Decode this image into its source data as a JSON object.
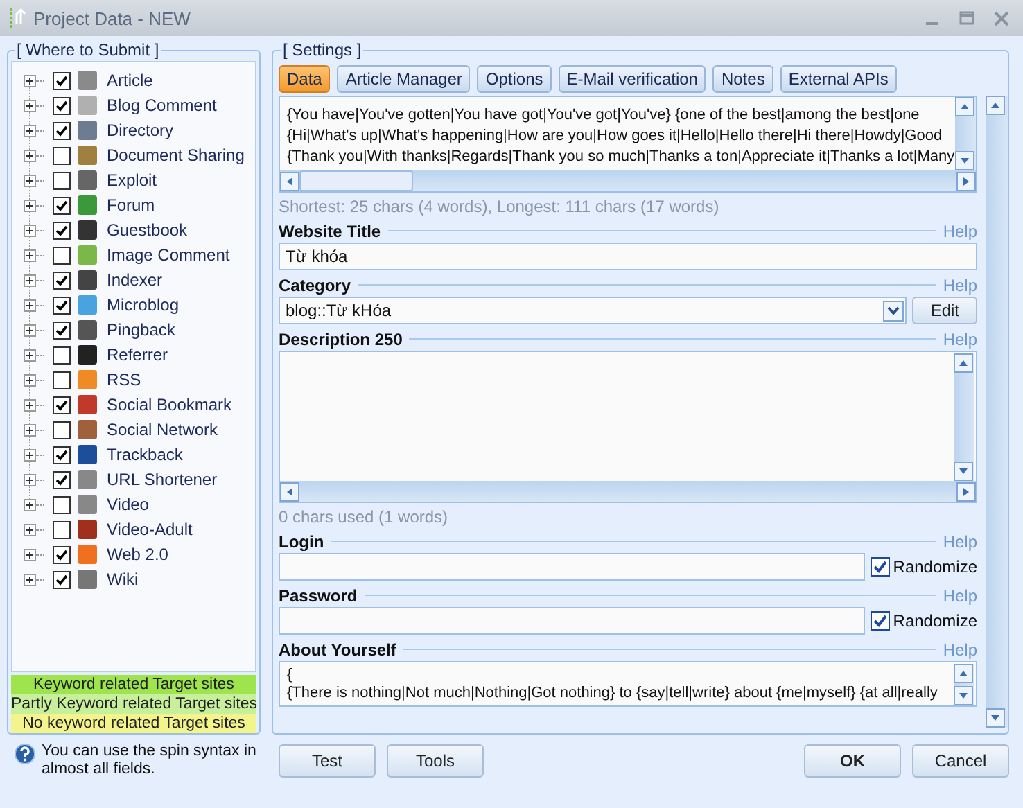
{
  "window": {
    "title": "Project Data - NEW"
  },
  "where_to_submit": {
    "title": "[ Where to Submit ]",
    "items": [
      {
        "label": "Article",
        "checked": true
      },
      {
        "label": "Blog Comment",
        "checked": true
      },
      {
        "label": "Directory",
        "checked": true
      },
      {
        "label": "Document Sharing",
        "checked": false
      },
      {
        "label": "Exploit",
        "checked": false
      },
      {
        "label": "Forum",
        "checked": true
      },
      {
        "label": "Guestbook",
        "checked": true
      },
      {
        "label": "Image Comment",
        "checked": false
      },
      {
        "label": "Indexer",
        "checked": true
      },
      {
        "label": "Microblog",
        "checked": true
      },
      {
        "label": "Pingback",
        "checked": true
      },
      {
        "label": "Referrer",
        "checked": false
      },
      {
        "label": "RSS",
        "checked": false
      },
      {
        "label": "Social Bookmark",
        "checked": true
      },
      {
        "label": "Social Network",
        "checked": false
      },
      {
        "label": "Trackback",
        "checked": true
      },
      {
        "label": "URL Shortener",
        "checked": true
      },
      {
        "label": "Video",
        "checked": false
      },
      {
        "label": "Video-Adult",
        "checked": false
      },
      {
        "label": "Web 2.0",
        "checked": true
      },
      {
        "label": "Wiki",
        "checked": true
      }
    ],
    "legend": [
      {
        "label": "Keyword related Target sites",
        "color": "#9ee44c"
      },
      {
        "label": "Partly Keyword related Target sites",
        "color": "#c8f09c"
      },
      {
        "label": "No keyword related Target sites",
        "color": "#f4f48c"
      }
    ]
  },
  "hint": "You can use the spin syntax in almost all fields.",
  "settings": {
    "title": "[ Settings ]",
    "tabs": [
      {
        "label": "Data",
        "selected": true
      },
      {
        "label": "Article Manager",
        "selected": false
      },
      {
        "label": "Options",
        "selected": false
      },
      {
        "label": "E-Mail verification",
        "selected": false
      },
      {
        "label": "Notes",
        "selected": false
      },
      {
        "label": "External APIs",
        "selected": false
      }
    ],
    "spin_lines": [
      "{You have|You've gotten|You have got|You've got|You've} {one of the best|among the best|one",
      "{Hi|What's up|What's happening|How are you|How goes it|Hello|Hello there|Hi there|Howdy|Good",
      "{Thank you|With thanks|Regards|Thank you so much|Thanks a ton|Appreciate it|Thanks a lot|Many"
    ],
    "spin_stats": "Shortest: 25 chars (4 words), Longest: 111 chars (17 words)",
    "fields": [
      {
        "kind": "text",
        "label": "Website Title",
        "help": "Help",
        "value": "Từ khóa"
      },
      {
        "kind": "select",
        "label": "Category",
        "help": "Help",
        "value": "blog::Từ kHóa",
        "button": "Edit"
      },
      {
        "kind": "textarea",
        "label": "Description 250",
        "help": "Help",
        "counter": "0 chars used (1 words)"
      },
      {
        "kind": "random",
        "label": "Login",
        "help": "Help",
        "randomize": {
          "label": "Randomize",
          "checked": true
        }
      },
      {
        "kind": "random",
        "label": "Password",
        "help": "Help",
        "randomize": {
          "label": "Randomize",
          "checked": true
        }
      },
      {
        "kind": "memo",
        "label": "About Yourself",
        "help": "Help",
        "lines": [
          "{",
          "{There is nothing|Not much|Nothing|Got nothing} to {say|tell|write} about {me|myself} {at all|really"
        ]
      }
    ]
  },
  "buttons_left": [
    "Test",
    "Tools"
  ],
  "buttons_right": [
    {
      "label": "OK",
      "default": true
    },
    {
      "label": "Cancel",
      "default": false
    }
  ]
}
